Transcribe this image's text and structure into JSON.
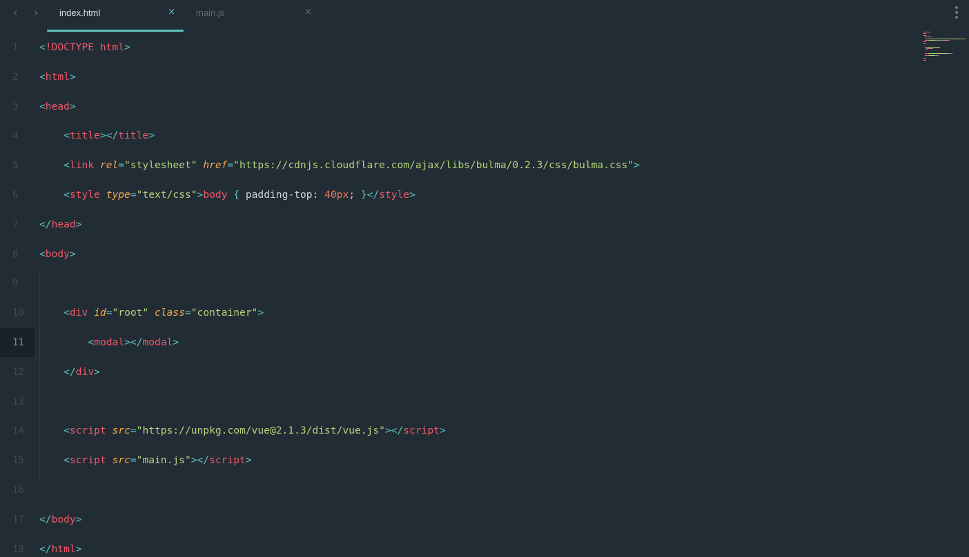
{
  "tabs": [
    {
      "label": "index.html",
      "close": "×",
      "active": true
    },
    {
      "label": "main.js",
      "close": "×",
      "active": false
    }
  ],
  "nav": {
    "back": "‹",
    "forward": "›"
  },
  "current_line": 11,
  "colors": {
    "background": "#222c34",
    "accent": "#5fc4c0",
    "tag": "#f0596a",
    "attribute": "#f5a94a",
    "string": "#b5d57b",
    "number": "#f2775e"
  },
  "lines": [
    {
      "n": "1",
      "indent": 0,
      "tokens": [
        [
          "ph",
          "<"
        ],
        [
          "tg",
          "!DOCTYPE html"
        ],
        [
          "ph",
          ">"
        ]
      ]
    },
    {
      "n": "2",
      "indent": 0,
      "tokens": [
        [
          "ph",
          "<"
        ],
        [
          "tg",
          "html"
        ],
        [
          "ph",
          ">"
        ]
      ]
    },
    {
      "n": "3",
      "indent": 0,
      "tokens": [
        [
          "ph",
          "<"
        ],
        [
          "tg",
          "head"
        ],
        [
          "ph",
          ">"
        ]
      ]
    },
    {
      "n": "4",
      "indent": 1,
      "tokens": [
        [
          "ph",
          "<"
        ],
        [
          "tg",
          "title"
        ],
        [
          "ph",
          "></"
        ],
        [
          "tg",
          "title"
        ],
        [
          "ph",
          ">"
        ]
      ]
    },
    {
      "n": "5",
      "indent": 1,
      "tokens": [
        [
          "ph",
          "<"
        ],
        [
          "tg",
          "link "
        ],
        [
          "at",
          "rel"
        ],
        [
          "ph",
          "="
        ],
        [
          "st",
          "\"stylesheet\""
        ],
        [
          "tx",
          " "
        ],
        [
          "at",
          "href"
        ],
        [
          "ph",
          "="
        ],
        [
          "st",
          "\"https://cdnjs.cloudflare.com/ajax/libs/bulma/0.2.3/css/bulma.css\""
        ],
        [
          "ph",
          ">"
        ]
      ]
    },
    {
      "n": "6",
      "indent": 1,
      "tokens": [
        [
          "ph",
          "<"
        ],
        [
          "tg",
          "style "
        ],
        [
          "at",
          "type"
        ],
        [
          "ph",
          "="
        ],
        [
          "st",
          "\"text/css\""
        ],
        [
          "ph",
          ">"
        ],
        [
          "tg",
          "body"
        ],
        [
          "tx",
          " "
        ],
        [
          "ph",
          "{"
        ],
        [
          "tx",
          " padding-top: "
        ],
        [
          "nm",
          "40px"
        ],
        [
          "tx",
          "; "
        ],
        [
          "ph",
          "}"
        ],
        [
          "ph",
          "</"
        ],
        [
          "tg",
          "style"
        ],
        [
          "ph",
          ">"
        ]
      ]
    },
    {
      "n": "7",
      "indent": 0,
      "tokens": [
        [
          "ph",
          "</"
        ],
        [
          "tg",
          "head"
        ],
        [
          "ph",
          ">"
        ]
      ]
    },
    {
      "n": "8",
      "indent": 0,
      "tokens": [
        [
          "ph",
          "<"
        ],
        [
          "tg",
          "body"
        ],
        [
          "ph",
          ">"
        ]
      ]
    },
    {
      "n": "9",
      "indent": 0,
      "tokens": []
    },
    {
      "n": "10",
      "indent": 1,
      "tokens": [
        [
          "ph",
          "<"
        ],
        [
          "tg",
          "div "
        ],
        [
          "at",
          "id"
        ],
        [
          "ph",
          "="
        ],
        [
          "st",
          "\"root\""
        ],
        [
          "tx",
          " "
        ],
        [
          "at",
          "class"
        ],
        [
          "ph",
          "="
        ],
        [
          "st",
          "\"container\""
        ],
        [
          "ph",
          ">"
        ]
      ]
    },
    {
      "n": "11",
      "indent": 2,
      "tokens": [
        [
          "ph",
          "<"
        ],
        [
          "tg",
          "modal"
        ],
        [
          "ph",
          "></"
        ],
        [
          "tg",
          "modal"
        ],
        [
          "ph",
          ">"
        ]
      ]
    },
    {
      "n": "12",
      "indent": 1,
      "tokens": [
        [
          "ph",
          "</"
        ],
        [
          "tg",
          "div"
        ],
        [
          "ph",
          ">"
        ]
      ]
    },
    {
      "n": "13",
      "indent": 0,
      "tokens": []
    },
    {
      "n": "14",
      "indent": 1,
      "tokens": [
        [
          "ph",
          "<"
        ],
        [
          "tg",
          "script "
        ],
        [
          "at",
          "src"
        ],
        [
          "ph",
          "="
        ],
        [
          "st",
          "\"https://unpkg.com/vue@2.1.3/dist/vue.js\""
        ],
        [
          "ph",
          "></"
        ],
        [
          "tg",
          "script"
        ],
        [
          "ph",
          ">"
        ]
      ]
    },
    {
      "n": "15",
      "indent": 1,
      "tokens": [
        [
          "ph",
          "<"
        ],
        [
          "tg",
          "script "
        ],
        [
          "at",
          "src"
        ],
        [
          "ph",
          "="
        ],
        [
          "st",
          "\"main.js\""
        ],
        [
          "ph",
          "></"
        ],
        [
          "tg",
          "script"
        ],
        [
          "ph",
          ">"
        ]
      ]
    },
    {
      "n": "16",
      "indent": 0,
      "tokens": []
    },
    {
      "n": "17",
      "indent": 0,
      "tokens": [
        [
          "ph",
          "</"
        ],
        [
          "tg",
          "body"
        ],
        [
          "ph",
          ">"
        ]
      ]
    },
    {
      "n": "18",
      "indent": 0,
      "tokens": [
        [
          "ph",
          "</"
        ],
        [
          "tg",
          "html"
        ],
        [
          "ph",
          ">"
        ]
      ]
    }
  ]
}
